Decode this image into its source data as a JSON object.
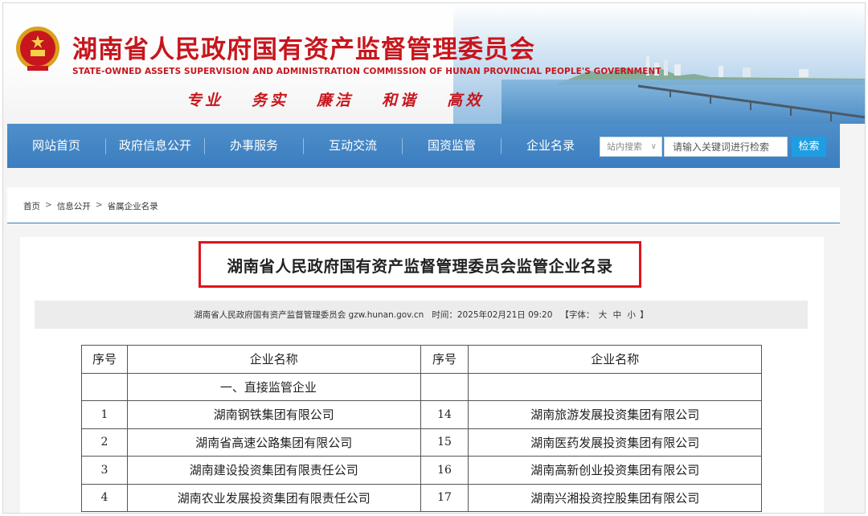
{
  "header": {
    "title": "湖南省人民政府国有资产监督管理委员会",
    "subtitle": "STATE-OWNED ASSETS SUPERVISION AND ADMINISTRATION COMMISSION OF HUNAN PROVINCIAL PEOPLE'S GOVERNMENT",
    "mottos": [
      "专业",
      "务实",
      "廉洁",
      "和谐",
      "高效"
    ],
    "brand_color": "#c7161d"
  },
  "nav": {
    "items": [
      "网站首页",
      "政府信息公开",
      "办事服务",
      "互动交流",
      "国资监管",
      "企业名录"
    ],
    "search_scope": "站内搜索",
    "search_placeholder": "请输入关键词进行检索",
    "search_button": "检索",
    "bar_color": "#3b7dbf"
  },
  "breadcrumb": [
    "首页",
    "信息公开",
    "省属企业名录"
  ],
  "article": {
    "title": "湖南省人民政府国有资产监督管理委员会监管企业名录",
    "source": "湖南省人民政府国有资产监督管理委员会 gzw.hunan.gov.cn",
    "time": "时间：2025年02月21日 09:20",
    "font_label_open": "【字体：",
    "font_sizes": [
      "大",
      "中",
      "小"
    ],
    "font_label_close": "】"
  },
  "table": {
    "headers": [
      "序号",
      "企业名称",
      "序号",
      "企业名称"
    ],
    "group_label": "一、直接监管企业",
    "rows": [
      {
        "no1": "1",
        "name1": "湖南钢铁集团有限公司",
        "no2": "14",
        "name2": "湖南旅游发展投资集团有限公司"
      },
      {
        "no1": "2",
        "name1": "湖南省高速公路集团有限公司",
        "no2": "15",
        "name2": "湖南医药发展投资集团有限公司"
      },
      {
        "no1": "3",
        "name1": "湖南建设投资集团有限责任公司",
        "no2": "16",
        "name2": "湖南高新创业投资集团有限公司"
      },
      {
        "no1": "4",
        "name1": "湖南农业发展投资集团有限责任公司",
        "no2": "17",
        "name2": "湖南兴湘投资控股集团有限公司"
      }
    ]
  }
}
